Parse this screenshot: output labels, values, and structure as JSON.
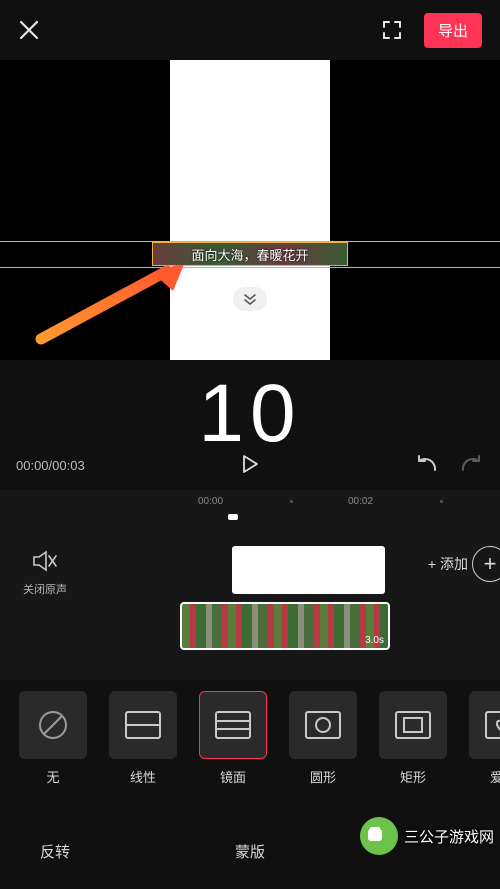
{
  "topbar": {
    "export_label": "导出"
  },
  "preview": {
    "caption_text": "面向大海，春暖花开",
    "big_number": "10"
  },
  "playbar": {
    "time_text": "00:00/00:03"
  },
  "timeline": {
    "ruler_t1": "00:00",
    "ruler_t2": "00:02",
    "mute_label": "关闭原声",
    "add_label": "+ 添加",
    "clip_duration": "3.0s"
  },
  "masks": {
    "items": [
      {
        "label": "无"
      },
      {
        "label": "线性"
      },
      {
        "label": "镜面"
      },
      {
        "label": "圆形"
      },
      {
        "label": "矩形"
      },
      {
        "label": "爱心"
      }
    ]
  },
  "tabs": {
    "invert": "反转",
    "mask": "蒙版"
  },
  "watermark": {
    "text": "三公子游戏网"
  }
}
